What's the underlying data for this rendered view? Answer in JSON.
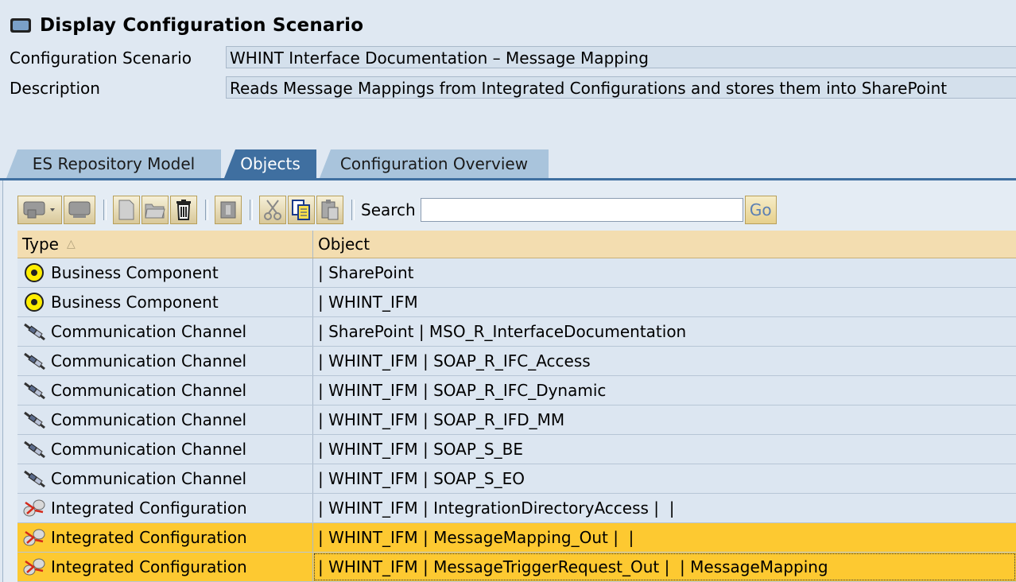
{
  "title": "Display Configuration Scenario",
  "fields": [
    {
      "label": "Configuration Scenario",
      "value": "WHINT Interface Documentation – Message Mapping"
    },
    {
      "label": "Description",
      "value": "Reads Message Mappings from Integrated Configurations and stores them into SharePoint"
    }
  ],
  "tabs": [
    {
      "label": "ES Repository Model"
    },
    {
      "label": "Objects"
    },
    {
      "label": "Configuration Overview"
    }
  ],
  "toolbar": {
    "search_label": "Search",
    "search_value": "",
    "go_label": "Go",
    "buttons": [
      "add-icon",
      "remove-icon",
      "new-document-icon",
      "open-folder-icon",
      "delete-icon",
      "info-icon",
      "cut-icon",
      "copy-icon",
      "paste-icon"
    ]
  },
  "table": {
    "columns": [
      "Type",
      "Object"
    ],
    "sort_column": "Type",
    "rows": [
      {
        "type": "Business Component",
        "object": "| SharePoint",
        "icon": "business-component-icon",
        "selected": false
      },
      {
        "type": "Business Component",
        "object": "| WHINT_IFM",
        "icon": "business-component-icon",
        "selected": false
      },
      {
        "type": "Communication Channel",
        "object": "| SharePoint | MSO_R_InterfaceDocumentation",
        "icon": "communication-channel-icon",
        "selected": false
      },
      {
        "type": "Communication Channel",
        "object": "| WHINT_IFM | SOAP_R_IFC_Access",
        "icon": "communication-channel-icon",
        "selected": false
      },
      {
        "type": "Communication Channel",
        "object": "| WHINT_IFM | SOAP_R_IFC_Dynamic",
        "icon": "communication-channel-icon",
        "selected": false
      },
      {
        "type": "Communication Channel",
        "object": "| WHINT_IFM | SOAP_R_IFD_MM",
        "icon": "communication-channel-icon",
        "selected": false
      },
      {
        "type": "Communication Channel",
        "object": "| WHINT_IFM | SOAP_S_BE",
        "icon": "communication-channel-icon",
        "selected": false
      },
      {
        "type": "Communication Channel",
        "object": "| WHINT_IFM | SOAP_S_EO",
        "icon": "communication-channel-icon",
        "selected": false
      },
      {
        "type": "Integrated Configuration",
        "object": "| WHINT_IFM | IntegrationDirectoryAccess |  |",
        "icon": "integrated-configuration-icon",
        "selected": false
      },
      {
        "type": "Integrated Configuration",
        "object": "| WHINT_IFM | MessageMapping_Out |  |",
        "icon": "integrated-configuration-icon",
        "selected": true
      },
      {
        "type": "Integrated Configuration",
        "object": "| WHINT_IFM | MessageTriggerRequest_Out |  | MessageMapping",
        "icon": "integrated-configuration-icon",
        "selected": true
      }
    ]
  },
  "colors": {
    "tab_active": "#3f6fa0",
    "tab_inactive": "#a9c4dc",
    "header_bg": "#f3ddb0",
    "row_selected": "#fdc931",
    "row_bg": "#dce6f1"
  }
}
